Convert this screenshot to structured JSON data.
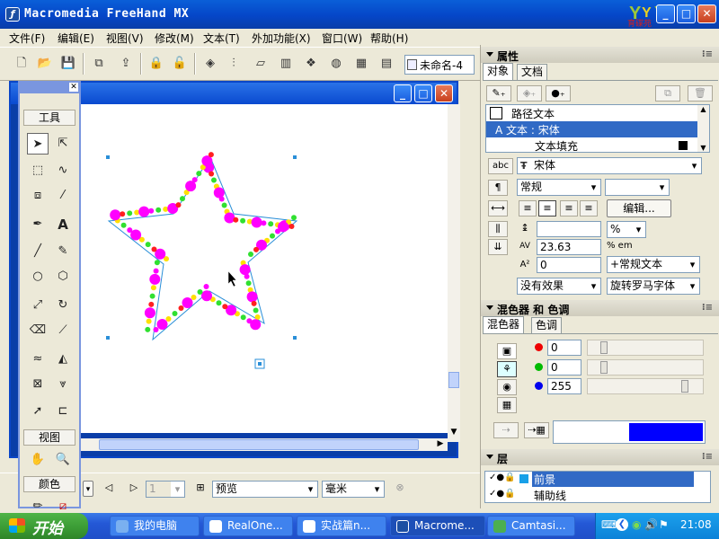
{
  "app": {
    "title": "Macromedia FreeHand MX",
    "doc_name": "未命名-4"
  },
  "menu": [
    "文件(F)",
    "编辑(E)",
    "视图(V)",
    "修改(M)",
    "文本(T)",
    "外加功能(X)",
    "窗口(W)",
    "帮助(H)"
  ],
  "tools_panel": {
    "title": "工具",
    "view_label": "视图",
    "color_label": "颜色"
  },
  "status": {
    "page": "1",
    "mode": "预览",
    "unit": "毫米"
  },
  "properties": {
    "title": "属性",
    "tabs": [
      "对象",
      "文档"
    ],
    "tree": [
      {
        "label": "路径文本"
      },
      {
        "label": "A  文本 : 宋体"
      },
      {
        "label": "文本填充"
      }
    ],
    "font": "宋体",
    "style": "常规",
    "edit_button": "编辑...",
    "percent": "%",
    "tracking": "23.63",
    "tracking_unit": "% em",
    "baseline": "0",
    "text_mode": "+常规文本",
    "effect": "没有效果",
    "rotate": "旋转罗马字体"
  },
  "mixer": {
    "title": "混色器 和 色调",
    "tabs": [
      "混色器",
      "色调"
    ],
    "r": "0",
    "g": "0",
    "b": "255",
    "swatch": "#0000ff"
  },
  "layers": {
    "title": "层",
    "items": [
      "前景",
      "辅助线"
    ]
  },
  "taskbar": {
    "start": "开始",
    "tasks": [
      "我的电脑",
      "RealOne...",
      "实战篇n...",
      "Macrome...",
      "Camtasi..."
    ],
    "clock": "21:08"
  },
  "logo_text": "育碟苑"
}
